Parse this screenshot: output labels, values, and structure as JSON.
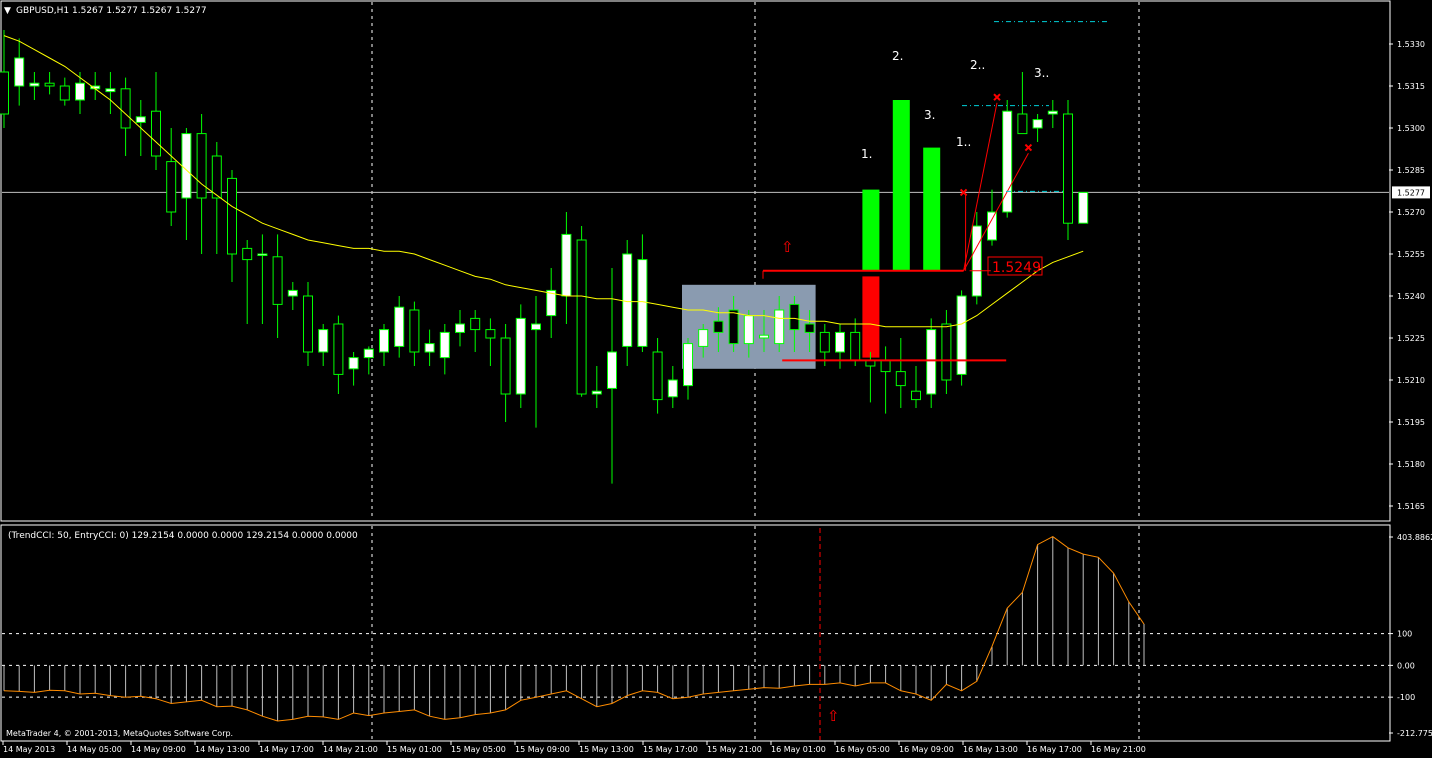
{
  "header": {
    "symbol_line": "GBPUSD,H1  1.5267 1.5277 1.5267 1.5277",
    "indicator_line": "(TrendCCI: 50, EntryCCI: 0)  129.2154 0.0000 0.0000 129.2154 0.0000 0.0000",
    "copyright": "MetaTrader 4, © 2001-2013, MetaQuotes Software Corp."
  },
  "colors": {
    "background": "#000000",
    "bull_body": "#ffffff",
    "bear_body": "#000000",
    "wick": "#00ff00",
    "ma_line": "#ffff00",
    "signal_green": "#00ff00",
    "signal_red": "#ff0000",
    "grid": "#ffffff",
    "zone_box": "#8a9bb0",
    "cci_line": "#ff8c00",
    "cci_hist": "#c0c0c0",
    "price_line": "#c0c0c0"
  },
  "price_axis": {
    "ticks": [
      "1.5330",
      "1.5315",
      "1.5300",
      "1.5285",
      "1.5270",
      "1.5255",
      "1.5240",
      "1.5225",
      "1.5210",
      "1.5195",
      "1.5180",
      "1.5165"
    ],
    "current_price": "1.5277"
  },
  "cci_axis": {
    "ticks": [
      "403.8862",
      "100",
      "0.00",
      "-100",
      "-212.775"
    ]
  },
  "time_axis": {
    "labels": [
      "14 May 2013",
      "14 May 05:00",
      "14 May 09:00",
      "14 May 13:00",
      "14 May 17:00",
      "14 May 21:00",
      "15 May 01:00",
      "15 May 05:00",
      "15 May 09:00",
      "15 May 13:00",
      "15 May 17:00",
      "15 May 21:00",
      "16 May 01:00",
      "16 May 05:00",
      "16 May 09:00",
      "16 May 13:00",
      "16 May 17:00",
      "16 May 21:00"
    ]
  },
  "annotations": {
    "level_label": "1.5249",
    "n1_bar": "1.",
    "n2_bar": "2.",
    "n3_bar": "3.",
    "n1_small": "1..",
    "n2_small": "2..",
    "n3_small": "3..",
    "arrow": "⇧"
  },
  "chart_data": [
    {
      "type": "candlestick",
      "title": "GBPUSD,H1",
      "ylim": [
        1.516,
        1.5345
      ],
      "moving_average": [
        1.5333,
        1.5331,
        1.5328,
        1.5325,
        1.5322,
        1.5318,
        1.5314,
        1.531,
        1.5305,
        1.53,
        1.5295,
        1.529,
        1.5285,
        1.528,
        1.5276,
        1.5272,
        1.5269,
        1.5266,
        1.5264,
        1.5262,
        1.526,
        1.5259,
        1.5258,
        1.5257,
        1.5257,
        1.5256,
        1.5256,
        1.5255,
        1.5253,
        1.5251,
        1.5249,
        1.5247,
        1.5246,
        1.5244,
        1.5243,
        1.5242,
        1.5241,
        1.524,
        1.524,
        1.5239,
        1.5239,
        1.5238,
        1.5238,
        1.5237,
        1.5236,
        1.5235,
        1.5235,
        1.5234,
        1.5234,
        1.5233,
        1.5233,
        1.5232,
        1.5232,
        1.5231,
        1.5231,
        1.523,
        1.523,
        1.523,
        1.5229,
        1.5229,
        1.5229,
        1.5229,
        1.5229,
        1.523,
        1.5233,
        1.5237,
        1.5241,
        1.5245,
        1.5249,
        1.5252,
        1.5254,
        1.5256
      ],
      "ohlc": [
        [
          1.532,
          1.5335,
          1.53,
          1.5305
        ],
        [
          1.5315,
          1.5332,
          1.5308,
          1.5325
        ],
        [
          1.5315,
          1.532,
          1.531,
          1.5316
        ],
        [
          1.5316,
          1.532,
          1.5312,
          1.5315
        ],
        [
          1.5315,
          1.5318,
          1.5308,
          1.531
        ],
        [
          1.531,
          1.532,
          1.5305,
          1.5316
        ],
        [
          1.5314,
          1.532,
          1.531,
          1.5315
        ],
        [
          1.5313,
          1.532,
          1.5305,
          1.5314
        ],
        [
          1.5314,
          1.5318,
          1.529,
          1.53
        ],
        [
          1.5302,
          1.531,
          1.529,
          1.5304
        ],
        [
          1.5306,
          1.532,
          1.5285,
          1.529
        ],
        [
          1.5288,
          1.53,
          1.5265,
          1.527
        ],
        [
          1.5275,
          1.53,
          1.526,
          1.5298
        ],
        [
          1.5298,
          1.5305,
          1.5255,
          1.5275
        ],
        [
          1.529,
          1.5295,
          1.5255,
          1.5275
        ],
        [
          1.5282,
          1.5285,
          1.5245,
          1.5255
        ],
        [
          1.5257,
          1.526,
          1.523,
          1.5253
        ],
        [
          1.5255,
          1.5262,
          1.523,
          1.5255
        ],
        [
          1.5254,
          1.5262,
          1.5225,
          1.5237
        ],
        [
          1.524,
          1.5245,
          1.5235,
          1.5242
        ],
        [
          1.524,
          1.5245,
          1.5215,
          1.522
        ],
        [
          1.522,
          1.523,
          1.5215,
          1.5228
        ],
        [
          1.523,
          1.5233,
          1.5205,
          1.5212
        ],
        [
          1.5214,
          1.522,
          1.5208,
          1.5218
        ],
        [
          1.5218,
          1.5222,
          1.5212,
          1.5221
        ],
        [
          1.522,
          1.523,
          1.5215,
          1.5228
        ],
        [
          1.5222,
          1.524,
          1.5218,
          1.5236
        ],
        [
          1.5235,
          1.5238,
          1.5215,
          1.522
        ],
        [
          1.522,
          1.5228,
          1.5215,
          1.5223
        ],
        [
          1.5218,
          1.523,
          1.5212,
          1.5227
        ],
        [
          1.5227,
          1.5235,
          1.5222,
          1.523
        ],
        [
          1.5232,
          1.5235,
          1.522,
          1.5228
        ],
        [
          1.5228,
          1.5232,
          1.5215,
          1.5225
        ],
        [
          1.5225,
          1.523,
          1.5195,
          1.5205
        ],
        [
          1.5205,
          1.5237,
          1.52,
          1.5232
        ],
        [
          1.5228,
          1.524,
          1.5193,
          1.523
        ],
        [
          1.5233,
          1.525,
          1.5225,
          1.5242
        ],
        [
          1.524,
          1.527,
          1.523,
          1.5262
        ],
        [
          1.526,
          1.5265,
          1.5204,
          1.5205
        ],
        [
          1.5205,
          1.5215,
          1.52,
          1.5206
        ],
        [
          1.5207,
          1.525,
          1.5173,
          1.522
        ],
        [
          1.5222,
          1.526,
          1.5215,
          1.5255
        ],
        [
          1.5222,
          1.5262,
          1.522,
          1.5253
        ],
        [
          1.522,
          1.5225,
          1.5198,
          1.5203
        ],
        [
          1.5204,
          1.5215,
          1.52,
          1.521
        ],
        [
          1.5208,
          1.5225,
          1.5203,
          1.5223
        ],
        [
          1.5222,
          1.523,
          1.5218,
          1.5228
        ],
        [
          1.5231,
          1.5236,
          1.522,
          1.5227
        ],
        [
          1.5235,
          1.524,
          1.522,
          1.5223
        ],
        [
          1.5223,
          1.5235,
          1.5218,
          1.5233
        ],
        [
          1.5225,
          1.5235,
          1.522,
          1.5226
        ],
        [
          1.5223,
          1.524,
          1.522,
          1.5235
        ],
        [
          1.5237,
          1.524,
          1.522,
          1.5228
        ],
        [
          1.523,
          1.5235,
          1.522,
          1.5227
        ],
        [
          1.5227,
          1.523,
          1.5215,
          1.522
        ],
        [
          1.522,
          1.523,
          1.5214,
          1.5227
        ],
        [
          1.5227,
          1.5232,
          1.5215,
          1.5217
        ],
        [
          1.5217,
          1.522,
          1.5202,
          1.5215
        ],
        [
          1.5217,
          1.5222,
          1.5198,
          1.5213
        ],
        [
          1.5213,
          1.5225,
          1.52,
          1.5208
        ],
        [
          1.5206,
          1.5215,
          1.52,
          1.5203
        ],
        [
          1.5205,
          1.5232,
          1.52,
          1.5228
        ],
        [
          1.523,
          1.5235,
          1.5205,
          1.521
        ],
        [
          1.5212,
          1.5242,
          1.5208,
          1.524
        ],
        [
          1.524,
          1.527,
          1.5237,
          1.5265
        ],
        [
          1.526,
          1.5278,
          1.5258,
          1.527
        ],
        [
          1.527,
          1.531,
          1.5268,
          1.5306
        ],
        [
          1.5305,
          1.532,
          1.5298,
          1.5298
        ],
        [
          1.53,
          1.5305,
          1.5295,
          1.5303
        ],
        [
          1.5305,
          1.531,
          1.53,
          1.5306
        ],
        [
          1.5305,
          1.531,
          1.526,
          1.5266
        ],
        [
          1.5266,
          1.5277,
          1.5266,
          1.5277
        ]
      ],
      "signal_bars_green": [
        1.5278,
        1.531,
        1.5293
      ],
      "signal_bars_base": 1.5249,
      "signal_bar_red": [
        1.5247,
        1.5218
      ],
      "zone_box": [
        1.5244,
        1.5214
      ],
      "level_line": 1.5249,
      "support_line": 1.5217,
      "dashed_levels": [
        1.5338,
        1.5308,
        1.5277
      ]
    },
    {
      "type": "histogram",
      "title": "TrendCCI",
      "ylim": [
        -212.775,
        403.8862
      ],
      "levels": [
        100,
        0,
        -100
      ],
      "values": [
        -80,
        -82,
        -85,
        -78,
        -80,
        -90,
        -88,
        -95,
        -100,
        -97,
        -105,
        -120,
        -115,
        -110,
        -130,
        -128,
        -140,
        -160,
        -175,
        -170,
        -160,
        -162,
        -170,
        -150,
        -158,
        -150,
        -145,
        -140,
        -160,
        -170,
        -165,
        -155,
        -150,
        -140,
        -110,
        -100,
        -90,
        -80,
        -105,
        -130,
        -120,
        -95,
        -80,
        -85,
        -105,
        -100,
        -90,
        -85,
        -80,
        -75,
        -70,
        -72,
        -65,
        -60,
        -60,
        -55,
        -65,
        -55,
        -55,
        -80,
        -90,
        -110,
        -60,
        -80,
        -50,
        60,
        180,
        230,
        380,
        405,
        370,
        350,
        340,
        290,
        200,
        130
      ]
    }
  ]
}
